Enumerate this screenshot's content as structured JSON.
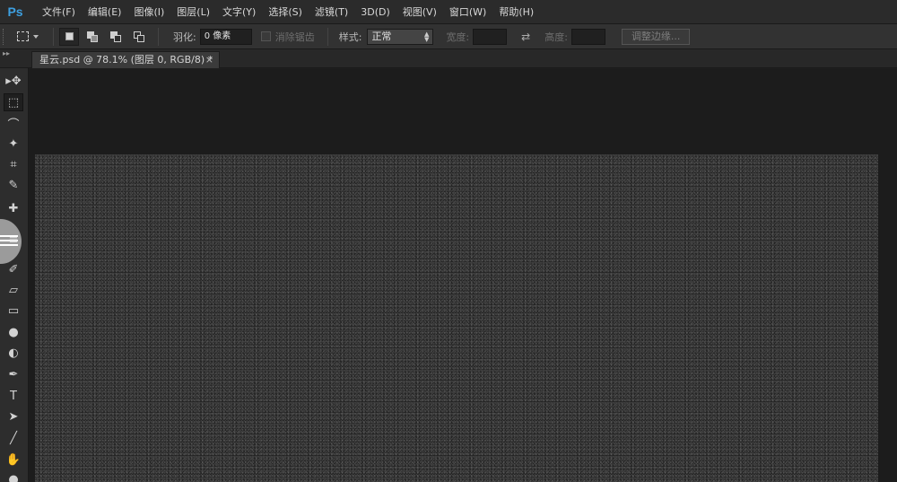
{
  "app": {
    "logo": "Ps"
  },
  "menu": [
    "文件(F)",
    "编辑(E)",
    "图像(I)",
    "图层(L)",
    "文字(Y)",
    "选择(S)",
    "滤镜(T)",
    "3D(D)",
    "视图(V)",
    "窗口(W)",
    "帮助(H)"
  ],
  "options": {
    "feather_label": "羽化:",
    "feather_value": "0 像素",
    "antialias_label": "消除锯齿",
    "style_label": "样式:",
    "style_value": "正常",
    "width_label": "宽度:",
    "height_label": "高度:",
    "refine_edge_label": "调整边缘..."
  },
  "document": {
    "tab_title": "星云.psd @ 78.1% (图层 0, RGB/8) *",
    "close_glyph": "×"
  },
  "toolbar": {
    "collapse_glyph": "▸▸",
    "tools": [
      {
        "name": "move-tool",
        "glyph": "▸✥"
      },
      {
        "name": "marquee-tool",
        "glyph": "⬚"
      },
      {
        "name": "lasso-tool",
        "glyph": "⌒"
      },
      {
        "name": "magic-wand-tool",
        "glyph": "✦"
      },
      {
        "name": "crop-tool",
        "glyph": "⌗"
      },
      {
        "name": "eyedropper-tool",
        "glyph": "✎"
      },
      {
        "name": "healing-brush-tool",
        "glyph": "✚"
      },
      {
        "name": "brush-tool",
        "glyph": "≡"
      },
      {
        "name": "history-brush-tool",
        "glyph": "✐"
      },
      {
        "name": "eraser-tool",
        "glyph": "▱"
      },
      {
        "name": "gradient-tool",
        "glyph": "▭"
      },
      {
        "name": "blur-tool",
        "glyph": "●"
      },
      {
        "name": "dodge-tool",
        "glyph": "◐"
      },
      {
        "name": "pen-tool",
        "glyph": "✒"
      },
      {
        "name": "type-tool",
        "glyph": "T"
      },
      {
        "name": "path-selection-tool",
        "glyph": "➤"
      },
      {
        "name": "line-tool",
        "glyph": "╱"
      },
      {
        "name": "hand-tool",
        "glyph": "✋"
      },
      {
        "name": "zoom-tool",
        "glyph": "●"
      }
    ]
  },
  "colors": {
    "brand": "#3d9fe0",
    "menubar": "#2b2b2b",
    "workspace": "#1c1c1c",
    "canvas": "#242424"
  }
}
